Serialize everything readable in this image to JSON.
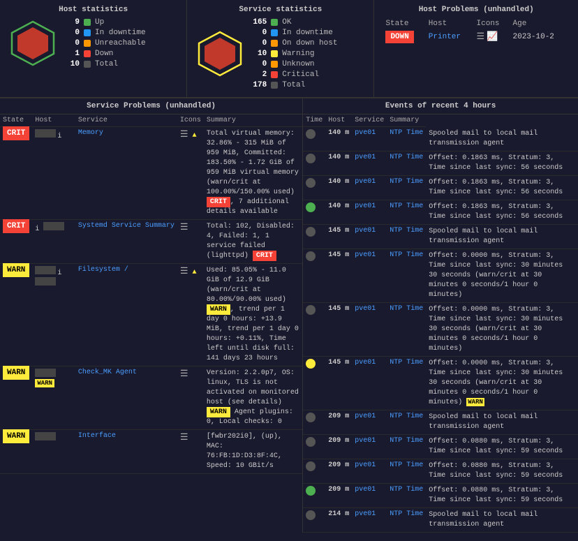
{
  "hostStats": {
    "title": "Host statistics",
    "rows": [
      {
        "num": "9",
        "label": "Up",
        "color": "green"
      },
      {
        "num": "0",
        "label": "In downtime",
        "color": "blue"
      },
      {
        "num": "0",
        "label": "Unreachable",
        "color": "orange"
      },
      {
        "num": "1",
        "label": "Down",
        "color": "red"
      },
      {
        "num": "10",
        "label": "Total",
        "color": "darkgray"
      }
    ]
  },
  "serviceStats": {
    "title": "Service statistics",
    "rows": [
      {
        "num": "165",
        "label": "OK",
        "color": "green"
      },
      {
        "num": "0",
        "label": "In downtime",
        "color": "blue"
      },
      {
        "num": "0",
        "label": "On down host",
        "color": "orange"
      },
      {
        "num": "10",
        "label": "Warning",
        "color": "yellow"
      },
      {
        "num": "0",
        "label": "Unknown",
        "color": "orange"
      },
      {
        "num": "2",
        "label": "Critical",
        "color": "red"
      },
      {
        "num": "178",
        "label": "Total",
        "color": "darkgray"
      }
    ]
  },
  "hostProblems": {
    "title": "Host Problems (unhandled)",
    "columns": [
      "State",
      "Host",
      "Icons",
      "Age"
    ],
    "rows": [
      {
        "state": "DOWN",
        "host": "Printer",
        "age": "2023-10-2"
      }
    ]
  },
  "serviceProblems": {
    "title": "Service Problems (unhandled)",
    "columns": [
      "State",
      "Host",
      "Service",
      "Icons",
      "Summary"
    ],
    "rows": [
      {
        "state": "CRIT",
        "service": "Memory",
        "summary": "Total virtual memory: 32.86% - 315 MiB of 959 MiB, Committed: 183.50% - 1.72 GiB of 959 MiB virtual memory (warn/crit at 100.00%/150.00% used)",
        "badge": "CRIT",
        "extra": "7 additional details available"
      },
      {
        "state": "CRIT",
        "service": "Systemd Service Summary",
        "summary": "Total: 102, Disabled: 4, Failed: 1, 1 service failed (lighttpd)",
        "badge": "CRIT",
        "extra": ""
      },
      {
        "state": "WARN",
        "service": "Filesystem /",
        "summary": "Used: 85.05% - 11.0 GiB of 12.9 GiB (warn/crit at 80.00%/90.00% used)",
        "badge": "WARN",
        "extra": "trend per 1 day 0 hours: +13.9 MiB, trend per 1 day 0 hours: +0.11%, Time left until disk full: 141 days 23 hours"
      },
      {
        "state": "WARN",
        "service": "Check_MK Agent",
        "summary": "Version: 2.2.0p7, OS: linux, TLS is not activated on monitored host (see details)",
        "badge": "WARN",
        "extra": "Agent plugins: 0, Local checks: 0"
      },
      {
        "state": "WARN",
        "service": "Interface",
        "summary": "[fwbr202i0], (up), MAC: 76:FB:1D:D3:8F:4C, Speed: 10 GBit/s",
        "badge": "",
        "extra": ""
      }
    ]
  },
  "events": {
    "title": "Events of recent 4 hours",
    "columns": [
      "Time",
      "Host",
      "Service",
      "Summary"
    ],
    "rows": [
      {
        "icon": "gray",
        "time": "140 m",
        "host": "pve01",
        "service": "NTP Time",
        "summary": "Spooled mail to local mail transmission agent"
      },
      {
        "icon": "gray",
        "time": "140 m",
        "host": "pve01",
        "service": "NTP Time",
        "summary": "Offset: 0.1863 ms, Stratum: 3, Time since last sync: 56 seconds"
      },
      {
        "icon": "gray",
        "time": "140 m",
        "host": "pve01",
        "service": "NTP Time",
        "summary": "Offset: 0.1863 ms, Stratum: 3, Time since last sync: 56 seconds"
      },
      {
        "icon": "green",
        "time": "140 m",
        "host": "pve01",
        "service": "NTP Time",
        "summary": "Offset: 0.1863 ms, Stratum: 3, Time since last sync: 56 seconds"
      },
      {
        "icon": "gray",
        "time": "145 m",
        "host": "pve01",
        "service": "NTP Time",
        "summary": "Spooled mail to local mail transmission agent"
      },
      {
        "icon": "gray",
        "time": "145 m",
        "host": "pve01",
        "service": "NTP Time",
        "summary": "Offset: 0.0000 ms, Stratum: 3, Time since last sync: 30 minutes 30 seconds (warn/crit at 30 minutes 0 seconds/1 hour 0 minutes)"
      },
      {
        "icon": "gray",
        "time": "145 m",
        "host": "pve01",
        "service": "NTP Time",
        "summary": "Offset: 0.0000 ms, Stratum: 3, Time since last sync: 30 minutes 30 seconds (warn/crit at 30 minutes 0 seconds/1 hour 0 minutes)"
      },
      {
        "icon": "yellow",
        "time": "145 m",
        "host": "pve01",
        "service": "NTP Time",
        "summary": "Offset: 0.0000 ms, Stratum: 3, Time since last sync: 30 minutes 30 seconds (warn/crit at 30 minutes 0 seconds/1 hour 0 minutes)"
      },
      {
        "icon": "gray",
        "time": "209 m",
        "host": "pve01",
        "service": "NTP Time",
        "summary": "Spooled mail to local mail transmission agent"
      },
      {
        "icon": "gray",
        "time": "209 m",
        "host": "pve01",
        "service": "NTP Time",
        "summary": "Offset: 0.0880 ms, Stratum: 3, Time since last sync: 59 seconds"
      },
      {
        "icon": "gray",
        "time": "209 m",
        "host": "pve01",
        "service": "NTP Time",
        "summary": "Offset: 0.0880 ms, Stratum: 3, Time since last sync: 59 seconds"
      },
      {
        "icon": "green",
        "time": "209 m",
        "host": "pve01",
        "service": "NTP Time",
        "summary": "Offset: 0.0880 ms, Stratum: 3, Time since last sync: 59 seconds"
      },
      {
        "icon": "gray",
        "time": "214 m",
        "host": "pve01",
        "service": "NTP Time",
        "summary": "Spooled mail to local mail transmission agent"
      }
    ]
  }
}
